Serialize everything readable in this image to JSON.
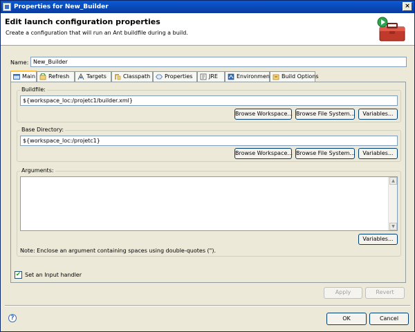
{
  "window": {
    "title": "Properties for New_Builder",
    "close_glyph": "×"
  },
  "header": {
    "title": "Edit launch configuration properties",
    "description": "Create a configuration that will run an Ant buildfile during a build."
  },
  "name": {
    "label": "Name:",
    "value": "New_Builder"
  },
  "tabs": [
    {
      "label": "Main",
      "icon": "main-icon"
    },
    {
      "label": "Refresh",
      "icon": "refresh-icon"
    },
    {
      "label": "Targets",
      "icon": "targets-icon"
    },
    {
      "label": "Classpath",
      "icon": "classpath-icon"
    },
    {
      "label": "Properties",
      "icon": "properties-icon"
    },
    {
      "label": "JRE",
      "icon": "jre-icon"
    },
    {
      "label": "Environment",
      "icon": "environment-icon"
    },
    {
      "label": "Build Options",
      "icon": "build-options-icon"
    }
  ],
  "buildfile": {
    "label": "Buildfile:",
    "value": "${workspace_loc:/projetc1/builder.xml}",
    "browse_workspace": "Browse Workspace...",
    "browse_filesystem": "Browse File System...",
    "variables": "Variables..."
  },
  "base_directory": {
    "label": "Base Directory:",
    "value": "${workspace_loc:/projetc1}",
    "browse_workspace": "Browse Workspace...",
    "browse_filesystem": "Browse File System...",
    "variables": "Variables..."
  },
  "arguments": {
    "label": "Arguments:",
    "value": "",
    "variables": "Variables...",
    "note": "Note: Enclose an argument containing spaces using double-quotes (\")."
  },
  "input_handler": {
    "label": "Set an Input handler",
    "checked": true,
    "check_glyph": "✔"
  },
  "footer": {
    "apply": "Apply",
    "revert": "Revert",
    "ok": "OK",
    "cancel": "Cancel",
    "help_glyph": "?"
  },
  "colors": {
    "title_bar": "#0a5ad4",
    "dialog_bg": "#ece9d8",
    "active_tab_accent": "#ffc83c",
    "toolbox_red": "#c0392b",
    "run_green": "#2ea44f"
  }
}
